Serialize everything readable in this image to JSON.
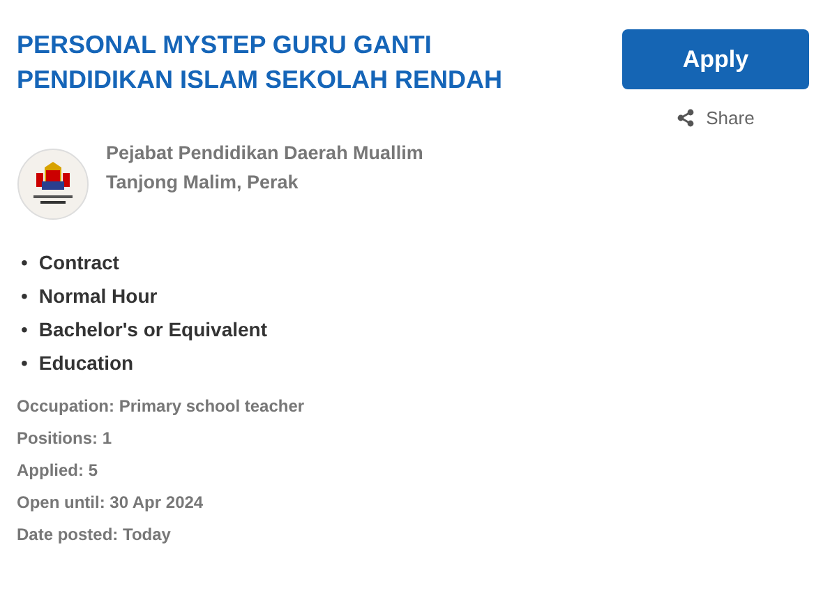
{
  "job": {
    "title": "PERSONAL MYSTEP GURU GANTI PENDIDIKAN ISLAM SEKOLAH RENDAH",
    "employer": "Pejabat Pendidikan Daerah Muallim",
    "location": "Tanjong Malim, Perak"
  },
  "actions": {
    "apply": "Apply",
    "share": "Share"
  },
  "tags": [
    {
      "bullet": "•",
      "text": "Contract"
    },
    {
      "bullet": "•",
      "text": "Normal Hour"
    },
    {
      "bullet": "•",
      "text": "Bachelor's or Equivalent"
    },
    {
      "bullet": "•",
      "text": "Education"
    }
  ],
  "details": [
    "Occupation: Primary school teacher",
    "Positions: 1",
    "Applied: 5",
    "Open until: 30 Apr 2024",
    "Date posted: Today"
  ]
}
